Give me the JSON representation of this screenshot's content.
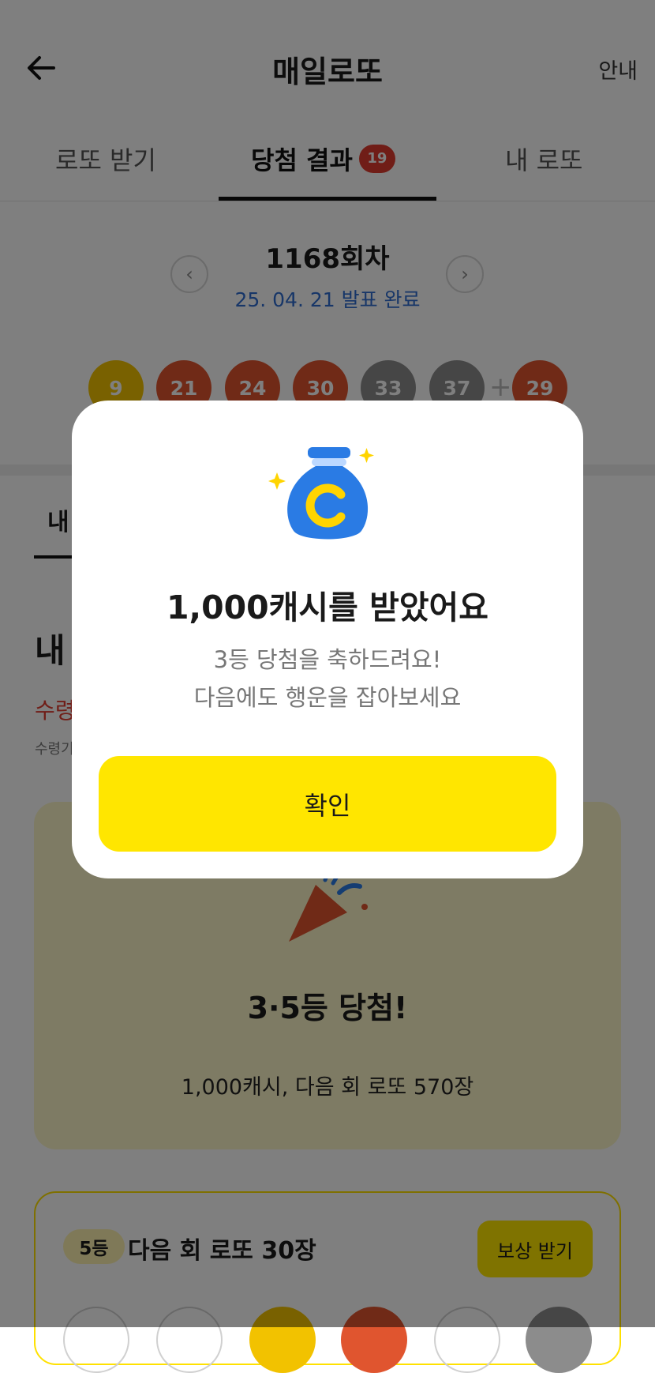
{
  "header": {
    "title": "매일로또",
    "guide_label": "안내"
  },
  "tabs": [
    {
      "label": "로또 받기"
    },
    {
      "label": "당첨 결과",
      "badge": "19"
    },
    {
      "label": "내 로또"
    }
  ],
  "round": {
    "title": "1168회차",
    "date": "25. 04. 21 발표 완료"
  },
  "balls": [
    {
      "number": "9",
      "color": "#f2c200"
    },
    {
      "number": "21",
      "color": "#e0552f"
    },
    {
      "number": "24",
      "color": "#e0552f"
    },
    {
      "number": "30",
      "color": "#e0552f"
    },
    {
      "number": "33",
      "color": "#8c8c8c"
    },
    {
      "number": "37",
      "color": "#8c8c8c"
    },
    {
      "number": "29",
      "color": "#e0552f"
    }
  ],
  "bonus_plus": "+",
  "below": {
    "sub_tab": "내",
    "heading": "내",
    "receive_label": "수령",
    "receive_small": "수령기",
    "win_title": "3·5등 당첨!",
    "win_desc": "1,000캐시, 다음 회 로또 570장"
  },
  "reward": {
    "rank": "5등",
    "text": "다음 회 로또 30장",
    "button": "보상 받기"
  },
  "modal": {
    "title": "1,000캐시를 받았어요",
    "line1": "3등 당첨을 축하드려요!",
    "line2": "다음에도 행운을 잡아보세요",
    "confirm": "확인"
  },
  "colors": {
    "accent_yellow": "#ffe600",
    "badge_red": "#e03b2e",
    "link_blue": "#2f6dd1",
    "bag_blue": "#2a7be4"
  }
}
